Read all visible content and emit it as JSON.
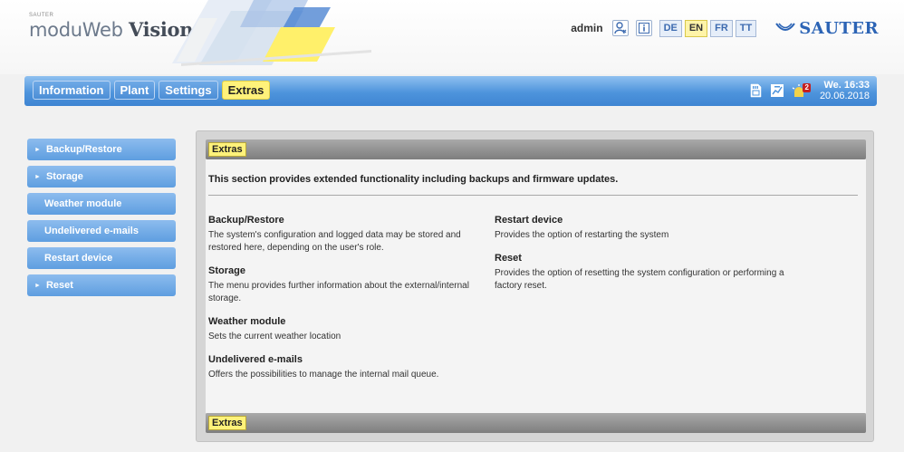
{
  "brand": {
    "small": "SAUTER",
    "name_light": "moduWeb",
    "name_bold": "Vision"
  },
  "header": {
    "user": "admin",
    "icons": [
      "user-icon",
      "info-icon"
    ],
    "languages": [
      {
        "code": "DE",
        "active": false
      },
      {
        "code": "EN",
        "active": true
      },
      {
        "code": "FR",
        "active": false
      },
      {
        "code": "TT",
        "active": false
      }
    ],
    "logo_text": "SAUTER"
  },
  "nav": {
    "tabs": [
      {
        "label": "Information",
        "active": false
      },
      {
        "label": "Plant",
        "active": false
      },
      {
        "label": "Settings",
        "active": false
      },
      {
        "label": "Extras",
        "active": true
      }
    ],
    "right_icons": [
      "sd-card-icon",
      "trend-icon",
      "alarm-icon"
    ],
    "alarm_count": "2",
    "clock": {
      "day_time": "We. 16:33",
      "date": "20.06.2018"
    }
  },
  "sidebar": {
    "items": [
      {
        "label": "Backup/Restore",
        "expandable": true
      },
      {
        "label": "Storage",
        "expandable": true
      },
      {
        "label": "Weather module",
        "expandable": false
      },
      {
        "label": "Undelivered e-mails",
        "expandable": false
      },
      {
        "label": "Restart device",
        "expandable": false
      },
      {
        "label": "Reset",
        "expandable": true
      }
    ]
  },
  "panel": {
    "header_chip": "Extras",
    "footer_chip": "Extras",
    "intro": "This section provides extended functionality including backups and firmware updates.",
    "left_sections": [
      {
        "title": "Backup/Restore",
        "desc": "The system's configuration and logged data may be stored and restored here, depending on the user's role."
      },
      {
        "title": "Storage",
        "desc": "The menu provides further information about the external/internal storage."
      },
      {
        "title": "Weather module",
        "desc": "Sets the current weather location"
      },
      {
        "title": "Undelivered e-mails",
        "desc": "Offers the possibilities to manage the internal mail queue."
      }
    ],
    "right_sections": [
      {
        "title": "Restart device",
        "desc": "Provides the option of restarting the system"
      },
      {
        "title": "Reset",
        "desc": "Provides the option of resetting the system configuration or performing a factory reset."
      }
    ]
  },
  "colors": {
    "nav_blue": "#4e94dc",
    "active_yellow": "#fff27a",
    "logo_blue": "#2c64b5",
    "alarm_red": "#c51f1f"
  }
}
